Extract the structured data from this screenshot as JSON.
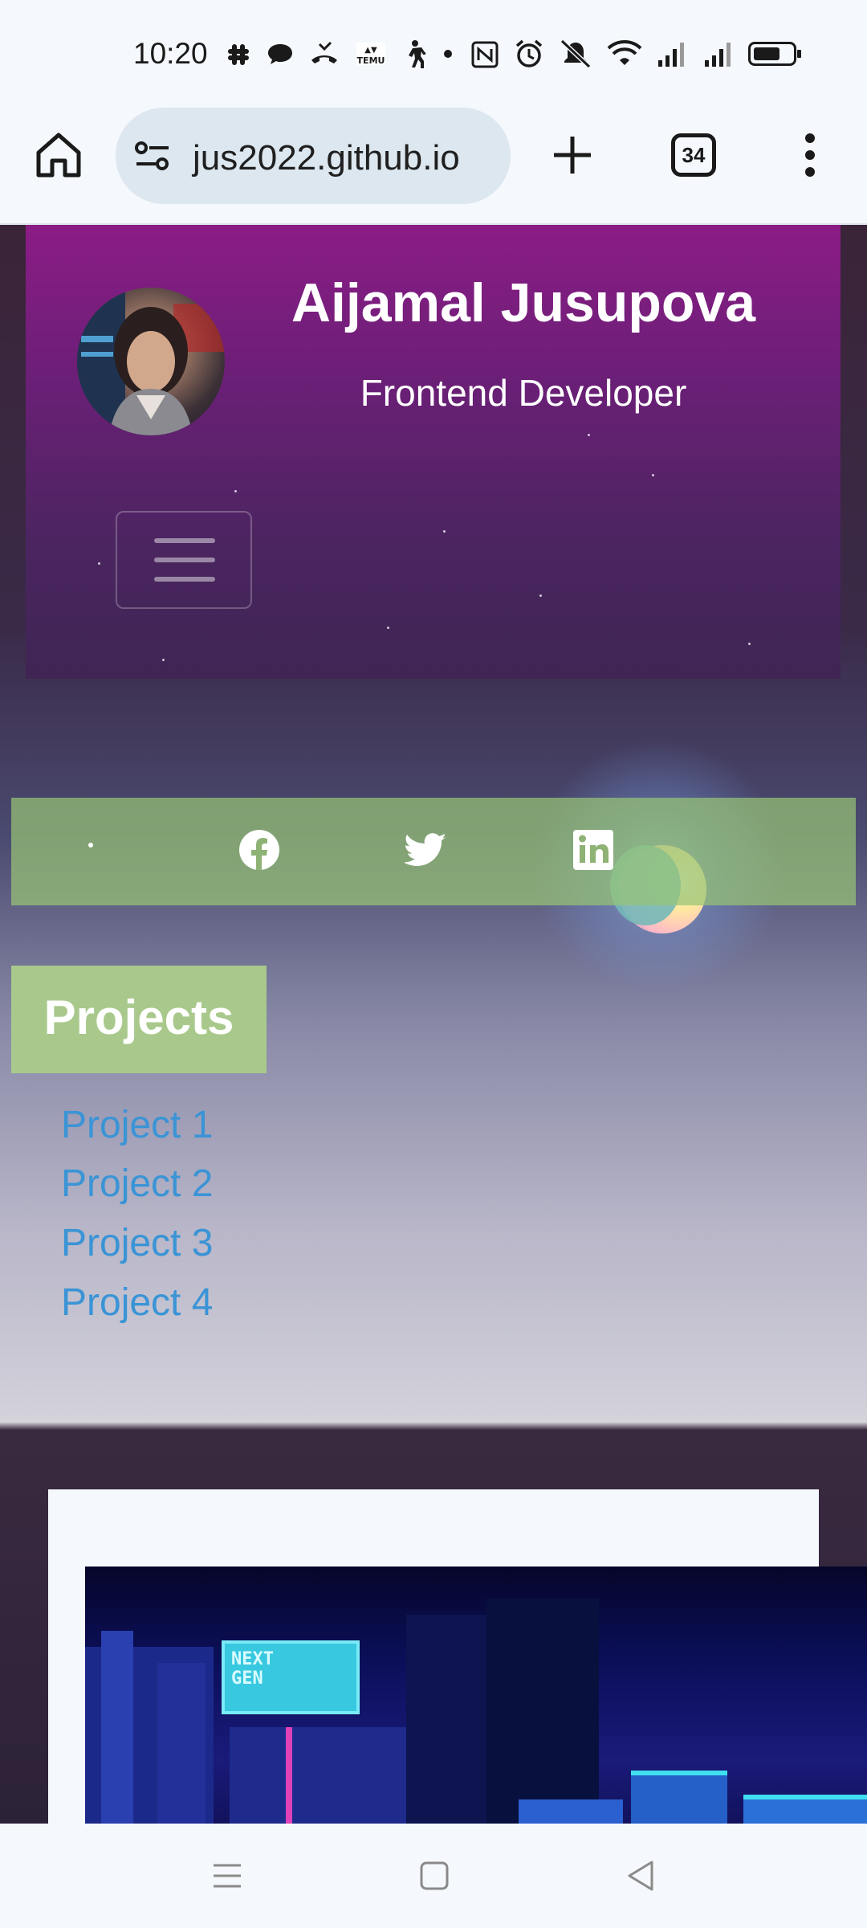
{
  "status_bar": {
    "time": "10:20",
    "icons": [
      "slack-icon",
      "chat-bubble-icon",
      "missed-call-icon",
      "temu-icon",
      "walking-icon",
      "dot-icon",
      "nfc-icon",
      "alarm-icon",
      "mute-icon",
      "wifi-icon",
      "signal-icon",
      "signal-icon",
      "battery-icon"
    ]
  },
  "browser": {
    "url": "jus2022.github.io",
    "tab_count": "34"
  },
  "profile": {
    "name": "Aijamal Jusupova",
    "role": "Frontend Developer"
  },
  "social": {
    "items": [
      "facebook-icon",
      "twitter-icon",
      "linkedin-icon"
    ]
  },
  "projects": {
    "title": "Projects",
    "links": [
      "Project 1",
      "Project 2",
      "Project 3",
      "Project 4"
    ]
  },
  "gallery": {
    "sign_text": "NEXT GEN"
  },
  "colors": {
    "header_top": "#8b1c86",
    "social_bar": "#97c376",
    "projects_tag": "#a9c98c",
    "link": "#3a94d6"
  }
}
